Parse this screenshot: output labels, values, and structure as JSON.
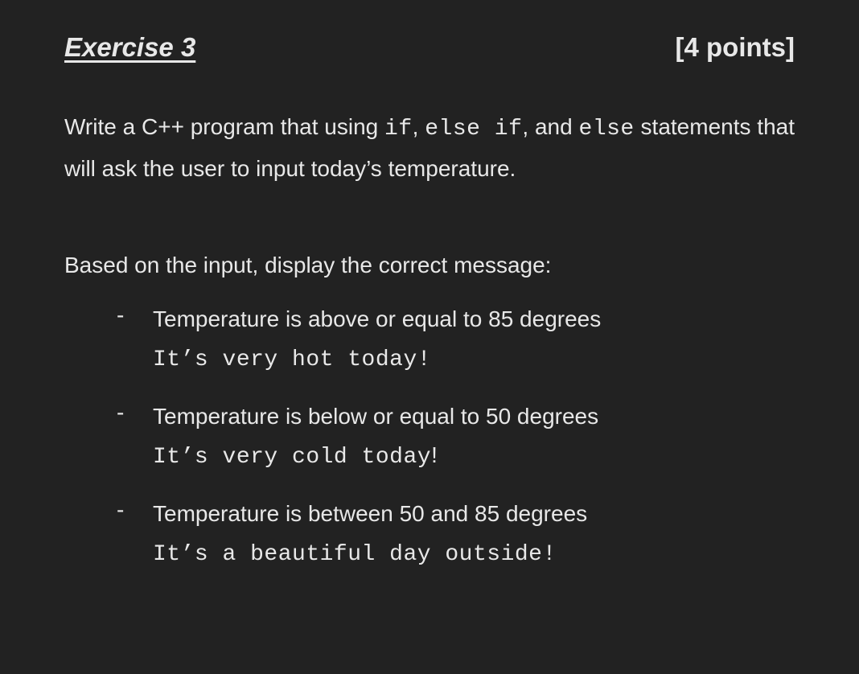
{
  "header": {
    "title": "Exercise 3",
    "points": "[4 points]"
  },
  "description": {
    "prefix": "Write a C++ program that using ",
    "code1": "if",
    "sep1": ", ",
    "code2": "else if",
    "sep2": ", and ",
    "code3": "else",
    "suffix": " statements that will ask the user to input today’s temperature."
  },
  "subheading": "Based on the input, display the correct message:",
  "conditions": [
    {
      "text": "Temperature is above or equal to 85 degrees",
      "output_mono": "It’s very hot today!",
      "output_plain": ""
    },
    {
      "text": "Temperature is below or equal to 50 degrees",
      "output_mono": "It’s very cold today",
      "output_plain": "!"
    },
    {
      "text": "Temperature is between 50 and 85 degrees",
      "output_mono": "It’s a beautiful day outside!",
      "output_plain": ""
    }
  ]
}
